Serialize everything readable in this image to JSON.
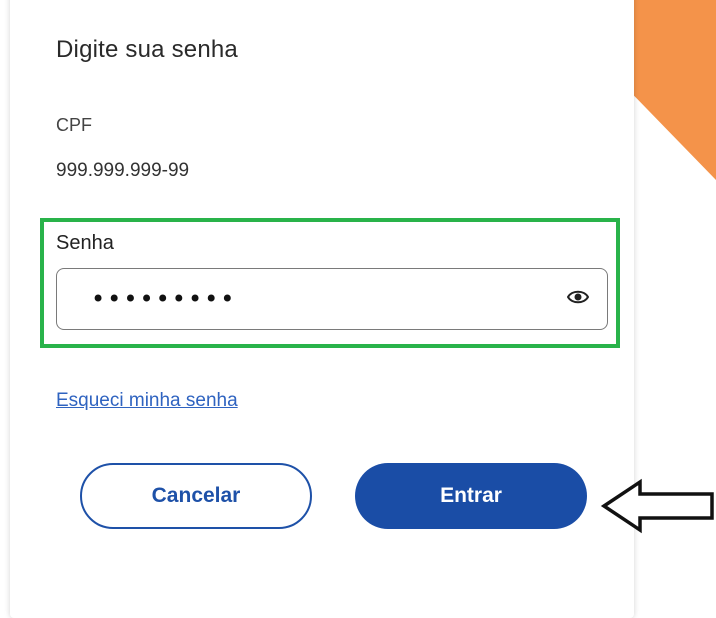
{
  "form": {
    "title": "Digite sua senha",
    "cpf_label": "CPF",
    "cpf_value": "999.999.999-99",
    "password_label": "Senha",
    "password_value": "•••••••••",
    "forgot_link": "Esqueci minha senha",
    "cancel_label": "Cancelar",
    "enter_label": "Entrar"
  },
  "icons": {
    "show_password": "eye-icon",
    "pointer": "arrow-left-icon"
  },
  "colors": {
    "accent_corner": "#f4934a",
    "highlight": "#29b34a",
    "primary": "#1a4da6",
    "link": "#2f63c0"
  }
}
